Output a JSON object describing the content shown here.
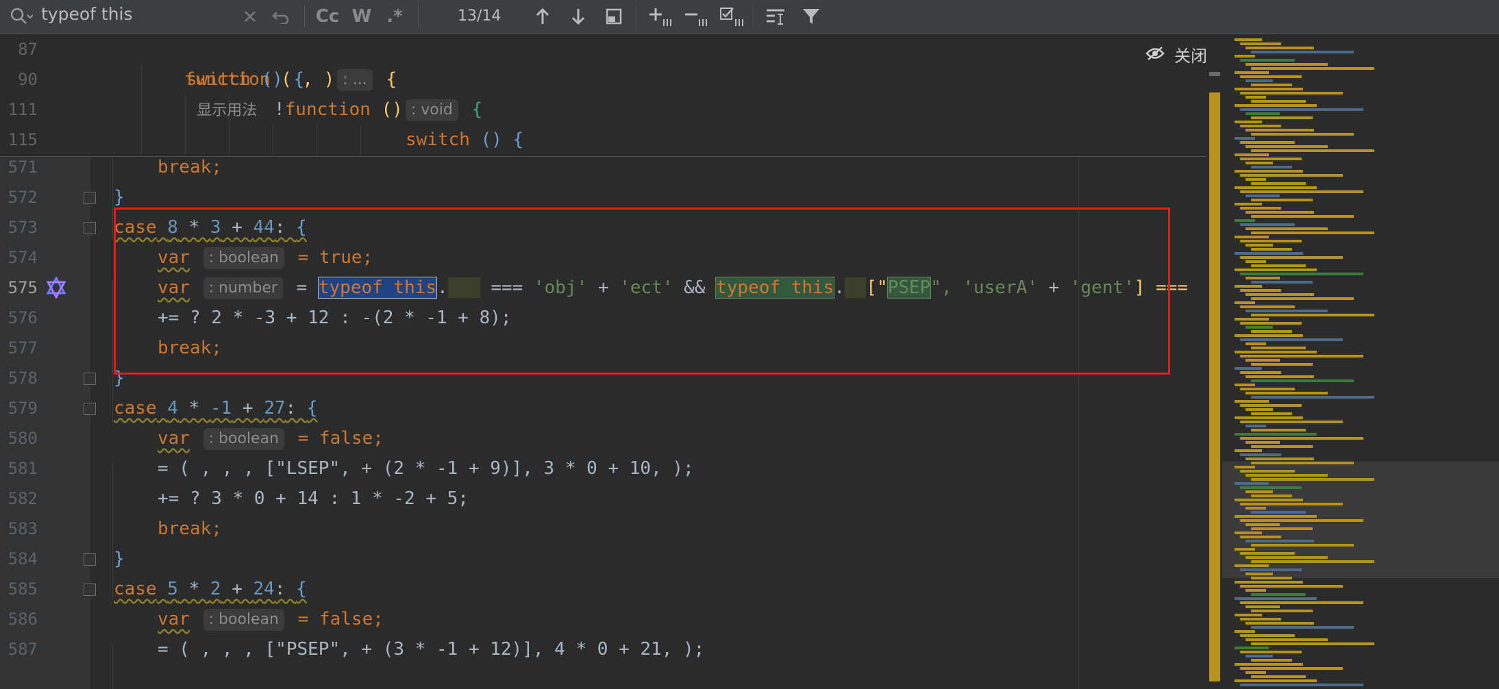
{
  "search": {
    "query": "typeof this",
    "match_count": "13/14"
  },
  "toolbar": {
    "match_case": "Cc",
    "words": "W",
    "regex": ".*"
  },
  "close_label": "关闭",
  "sticky": [
    {
      "num": "87",
      "indent": 0
    },
    {
      "num": "90",
      "indent": 1
    },
    {
      "num": "111",
      "indent": 2
    },
    {
      "num": "115",
      "indent": 3
    }
  ],
  "sticky_text": {
    "l87_kw": "function",
    "l87_args": " (",
    "l87_hint": ": ...",
    "l87_brace": "{",
    "l87_usage": "显示用法",
    "l90_kw": "switch",
    "l90_rest": " () {",
    "l111_bang": "!",
    "l111_kw": "function",
    "l111_rest": " ()",
    "l111_hint": ": void",
    "l111_brace": "{",
    "l115_kw": "switch",
    "l115_rest": " () {"
  },
  "lines": {
    "n571": "571",
    "n572": "572",
    "n573": "573",
    "n574": "574",
    "n575": "575",
    "n576": "576",
    "n577": "577",
    "n578": "578",
    "n579": "579",
    "n580": "580",
    "n581": "581",
    "n582": "582",
    "n583": "583",
    "n584": "584",
    "n585": "585",
    "n586": "586",
    "n587": "587"
  },
  "code": {
    "break": "break;",
    "close_brace": "}",
    "case": "case",
    "var": "var",
    "hint_boolean": ": boolean",
    "hint_number": ": number",
    "eq_true": " = true;",
    "eq_false": " = false;",
    "eq": " = ",
    "typeof_this": "typeof this",
    "dot": ".",
    "triple_eq": " === ",
    "s_obj": "'obj'",
    "plus": " + ",
    "s_ect": "'ect'",
    "and": " && ",
    "bracket_open": "[\"",
    "s_psep": "PSEP",
    "quote_comma": "\", ",
    "s_usera": "'userA'",
    "s_gent": "'gent'",
    "bracket_tail": "] ===",
    "l573_expr": [
      "8",
      " * ",
      "3",
      " + ",
      "44"
    ],
    "l576": "+= ? 2 * -3 + 12 : -(2 * -1 + 8);",
    "l579_expr": [
      "4",
      " * ",
      "-1",
      " + ",
      "27"
    ],
    "l581": "= ( , , , [\"LSEP\", + (2 * -1 + 9)], 3 * 0 + 10, );",
    "l582": "+= ? 3 * 0 + 14 : 1 * -2 + 5;",
    "l585_expr": [
      "5",
      " * ",
      "2",
      " + ",
      "24"
    ],
    "l587": "= ( , , , [\"PSEP\", + (3 * -1 + 12)], 4 * 0 + 21, );"
  }
}
